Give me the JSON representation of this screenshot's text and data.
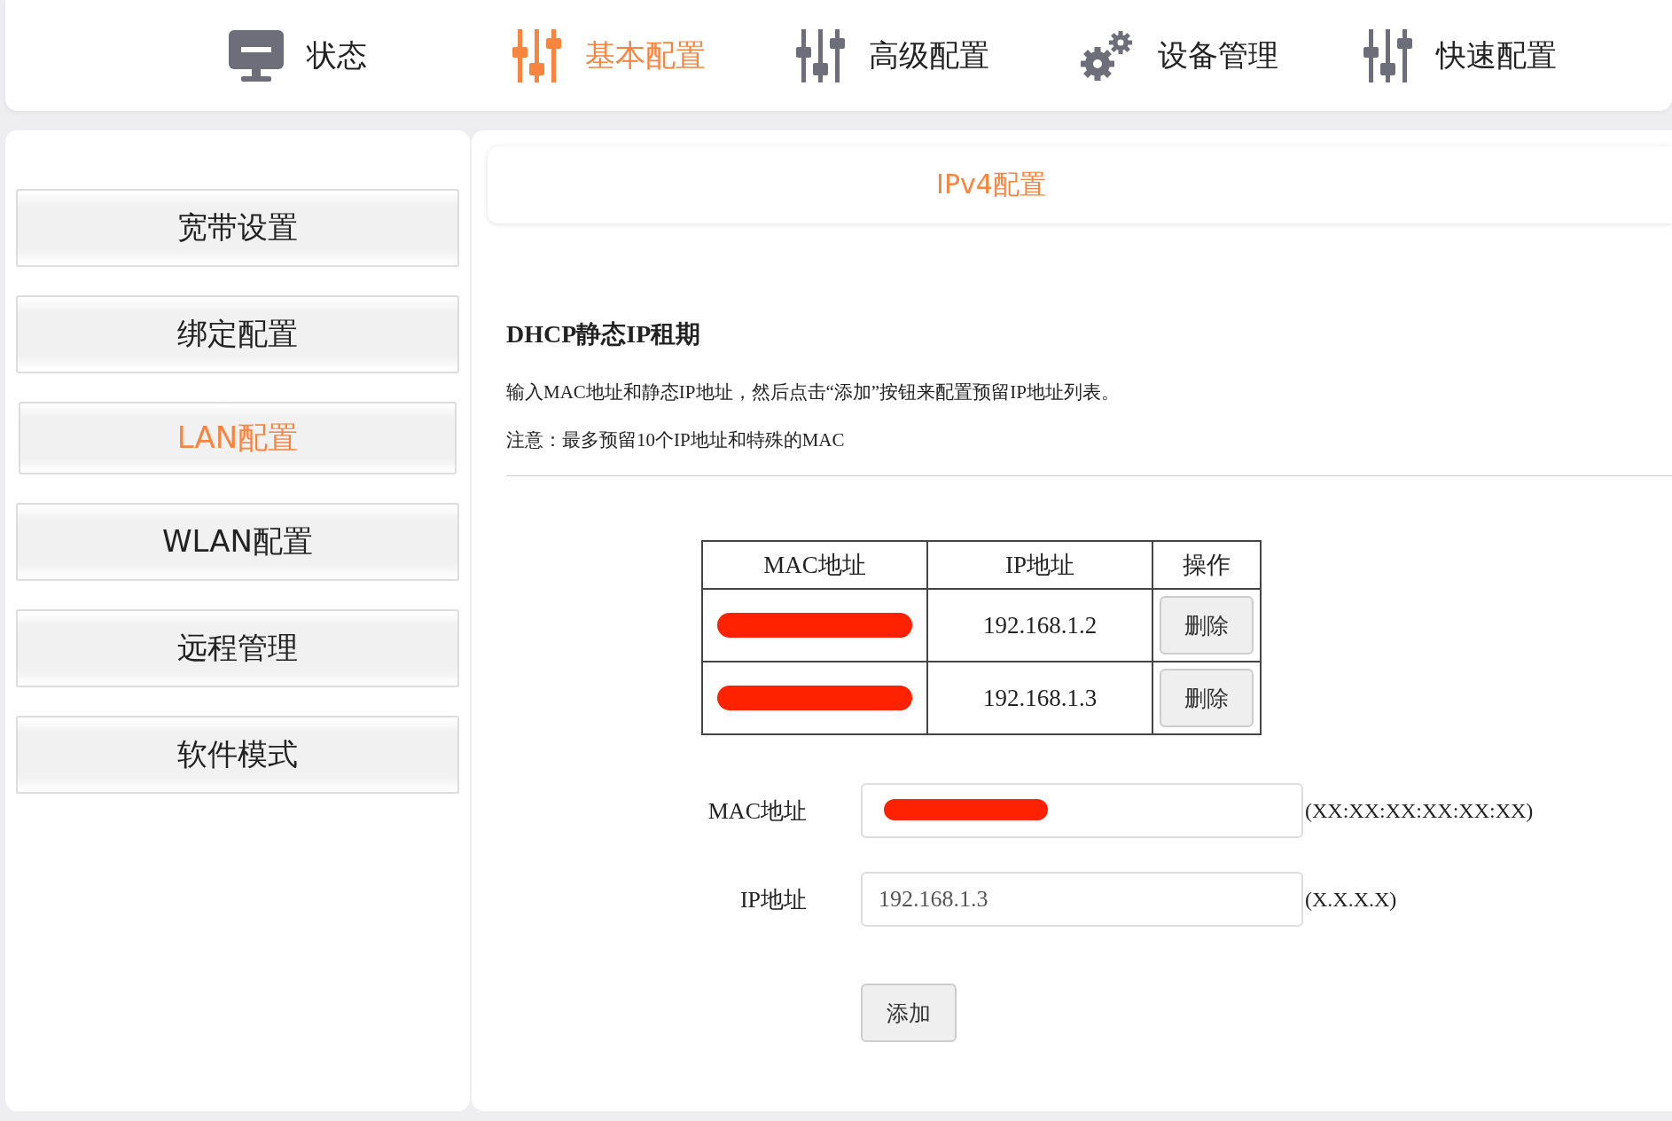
{
  "nav": [
    {
      "label": "状态",
      "kind": "monitor",
      "selected": false
    },
    {
      "label": "基本配置",
      "kind": "sliders",
      "selected": true
    },
    {
      "label": "高级配置",
      "kind": "sliders",
      "selected": false
    },
    {
      "label": "设备管理",
      "kind": "gears",
      "selected": false
    },
    {
      "label": "快速配置",
      "kind": "sliders",
      "selected": false
    }
  ],
  "sidebar": {
    "items": [
      {
        "label": "宽带设置",
        "selected": false
      },
      {
        "label": "绑定配置",
        "selected": false
      },
      {
        "label": "LAN配置",
        "selected": true
      },
      {
        "label": "WLAN配置",
        "selected": false
      },
      {
        "label": "远程管理",
        "selected": false
      },
      {
        "label": "软件模式",
        "selected": false
      }
    ]
  },
  "tab": {
    "label": "IPv4配置"
  },
  "section": {
    "title": "DHCP静态IP租期",
    "description": "输入MAC地址和静态IP地址，然后点击“添加”按钮来配置预留IP地址列表。",
    "note": "注意：最多预留10个IP地址和特殊的MAC"
  },
  "table": {
    "columns": [
      "MAC地址",
      "IP地址",
      "操作"
    ],
    "rows": [
      {
        "mac_redacted": true,
        "ip": "192.168.1.2",
        "action": "删除"
      },
      {
        "mac_redacted": true,
        "ip": "192.168.1.3",
        "action": "删除"
      }
    ]
  },
  "form": {
    "fields": [
      {
        "label": "MAC地址",
        "redacted": true,
        "hint": "(XX:XX:XX:XX:XX:XX)"
      },
      {
        "label": "IP地址",
        "value": "192.168.1.3",
        "hint": "(X.X.X.X)"
      }
    ],
    "submit": "添加"
  }
}
